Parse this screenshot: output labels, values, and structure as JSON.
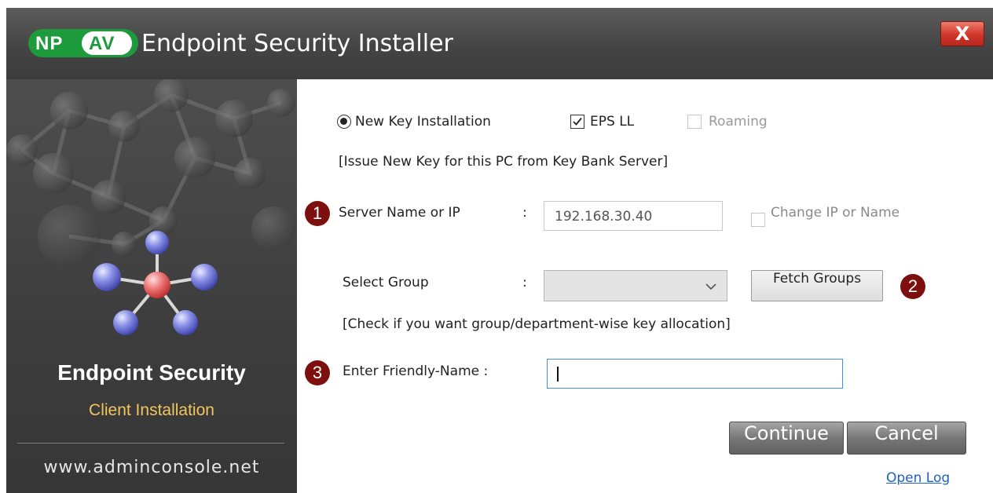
{
  "window": {
    "logo_np": "NP",
    "logo_av": "AV",
    "title": "Endpoint Security Installer",
    "close_label": "X"
  },
  "left_panel": {
    "title": "Endpoint Security",
    "subtitle": "Client Installation",
    "url": "www.adminconsole.net",
    "subtitle_color": "#f1c65e"
  },
  "form": {
    "install_option": "New Key Installation",
    "install_option_selected": true,
    "eps_ll_label": "EPS LL",
    "eps_ll_checked": true,
    "roaming_label": "Roaming",
    "roaming_checked": false,
    "note_new_key": "[Issue New Key for this PC from Key Bank Server]",
    "server_label": "Server Name or IP",
    "colon": ":",
    "server_value": "192.168.30.40",
    "change_ip_label": "Change IP or Name",
    "change_ip_checked": false,
    "group_label": "Select Group",
    "group_value": "",
    "fetch_groups_label": "Fetch Groups",
    "note_group": "[Check if you want group/department-wise key allocation]",
    "friendly_name_label": "Enter Friendly-Name :",
    "friendly_name_value": ""
  },
  "markers": [
    "1",
    "2",
    "3"
  ],
  "buttons": {
    "continue_label": "Continue",
    "cancel_label": "Cancel",
    "open_log_label": "Open Log"
  },
  "colors": {
    "brand_green": "#1c9a3c",
    "marker_red": "#7e0f0f",
    "link_blue": "#1f5fc6",
    "close_red": "#d0352a"
  }
}
